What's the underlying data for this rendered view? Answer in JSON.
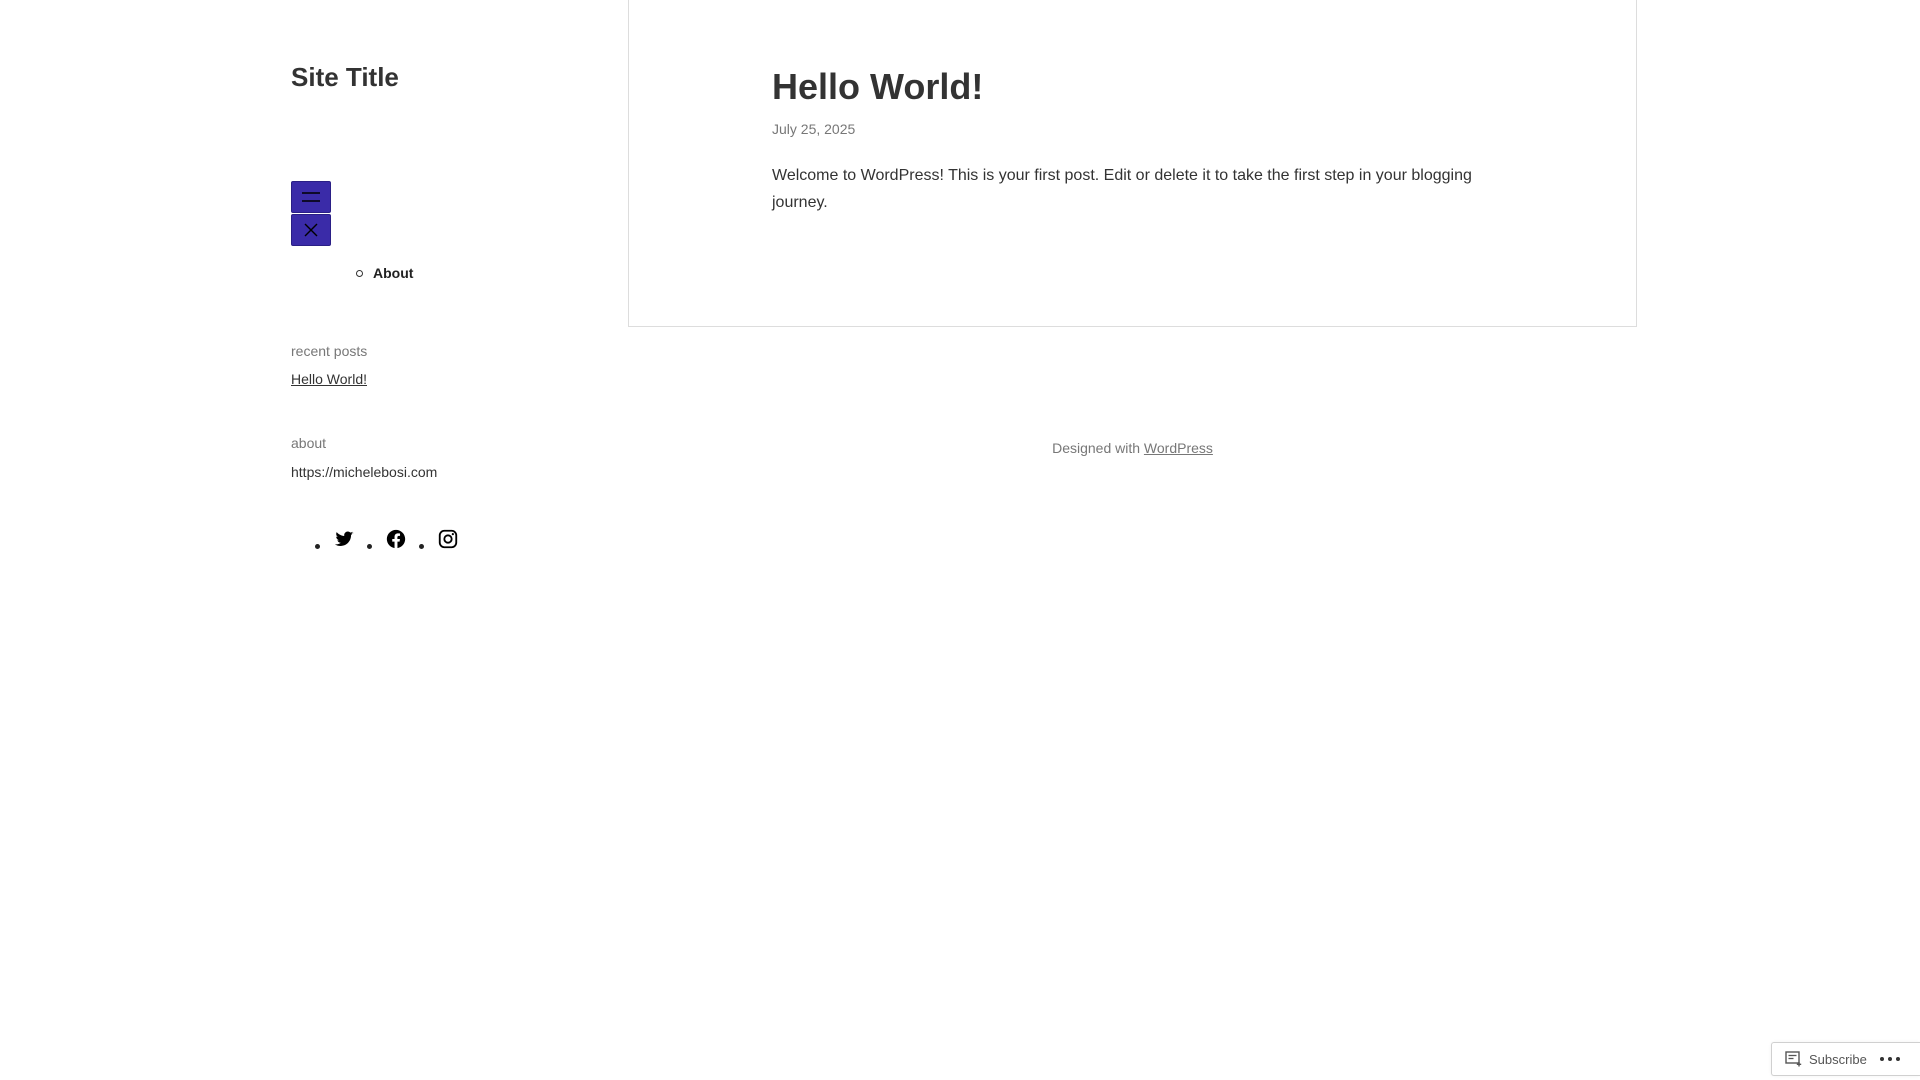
{
  "site": {
    "title": "Site Title"
  },
  "nav": {
    "open_menu_icon": "hamburger-icon",
    "close_menu_icon": "close-icon",
    "items": [
      {
        "label": "About"
      }
    ]
  },
  "widgets": {
    "recent_posts": {
      "title": "recent posts",
      "items": [
        {
          "label": "Hello World!"
        }
      ]
    },
    "about": {
      "title": "about",
      "text": "https://michelebosi.com"
    },
    "social": [
      {
        "icon": "twitter-icon"
      },
      {
        "icon": "facebook-icon"
      },
      {
        "icon": "instagram-icon"
      }
    ]
  },
  "post": {
    "title": "Hello World!",
    "date": "July 25, 2025",
    "body": "Welcome to WordPress! This is your first post. Edit or delete it to take the first step in your blogging journey."
  },
  "footer": {
    "prefix": "Designed with ",
    "link_label": "WordPress"
  },
  "subscribe_bar": {
    "subscribe_label": "Subscribe",
    "subscribe_icon": "reader-icon",
    "more_icon": "ellipsis-icon"
  },
  "colors": {
    "menu_button": "#3a2ba8",
    "text": "#333333",
    "muted": "#777777",
    "border": "#dddddd"
  }
}
